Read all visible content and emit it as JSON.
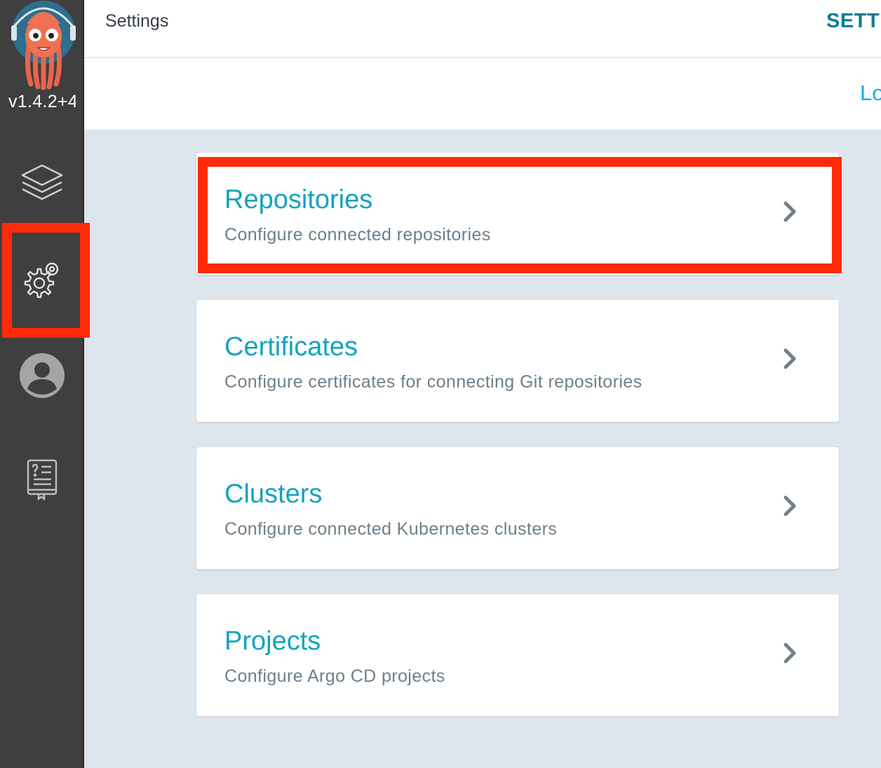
{
  "app": {
    "version": "v1.4.2+4",
    "colors": {
      "sidebar": "#3f3f3f",
      "accent": "#13a4bc",
      "highlight": "#ff2a0a",
      "background": "#dee6ed"
    }
  },
  "sidebar": {
    "logo_icon": "argo-octopus-logo",
    "items": [
      {
        "icon": "layers-icon",
        "name": "applications"
      },
      {
        "icon": "gears-icon",
        "name": "settings",
        "selected": true
      },
      {
        "icon": "user-icon",
        "name": "user-info"
      },
      {
        "icon": "help-book-icon",
        "name": "documentation"
      }
    ]
  },
  "header": {
    "title": "Settings",
    "breadcrumb": "SETTI"
  },
  "toolbar": {
    "link": "Lo"
  },
  "cards": [
    {
      "title": "Repositories",
      "description": "Configure connected repositories",
      "highlighted": true
    },
    {
      "title": "Certificates",
      "description": "Configure certificates for connecting Git repositories"
    },
    {
      "title": "Clusters",
      "description": "Configure connected Kubernetes clusters"
    },
    {
      "title": "Projects",
      "description": "Configure Argo CD projects"
    }
  ]
}
